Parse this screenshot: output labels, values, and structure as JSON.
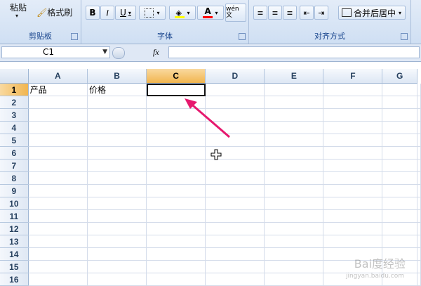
{
  "ribbon": {
    "clipboard": {
      "label": "剪贴板",
      "paste_label": "粘贴",
      "format_painter_label": "格式刷"
    },
    "font": {
      "label": "字体",
      "bold": "B",
      "italic": "I",
      "underline": "U",
      "phonetic": "wén 文"
    },
    "alignment": {
      "label": "对齐方式",
      "merge_center_label": "合并后居中"
    },
    "colors": {
      "fill": "#ffff00",
      "font": "#ff0000"
    }
  },
  "formula_bar": {
    "cell_ref": "C1",
    "fx_label": "fx",
    "formula": ""
  },
  "sheet": {
    "columns": [
      "A",
      "B",
      "C",
      "D",
      "E",
      "F",
      "G"
    ],
    "rows": [
      "1",
      "2",
      "3",
      "4",
      "5",
      "6",
      "7",
      "8",
      "9",
      "10",
      "11",
      "12",
      "13",
      "14",
      "15",
      "16"
    ],
    "cells": {
      "A1": "产品",
      "B1": "价格",
      "C1": ""
    },
    "selected_cell": "C1"
  },
  "watermark": {
    "text": "Bai度经验",
    "sub": "jingyan.baidu.com"
  }
}
